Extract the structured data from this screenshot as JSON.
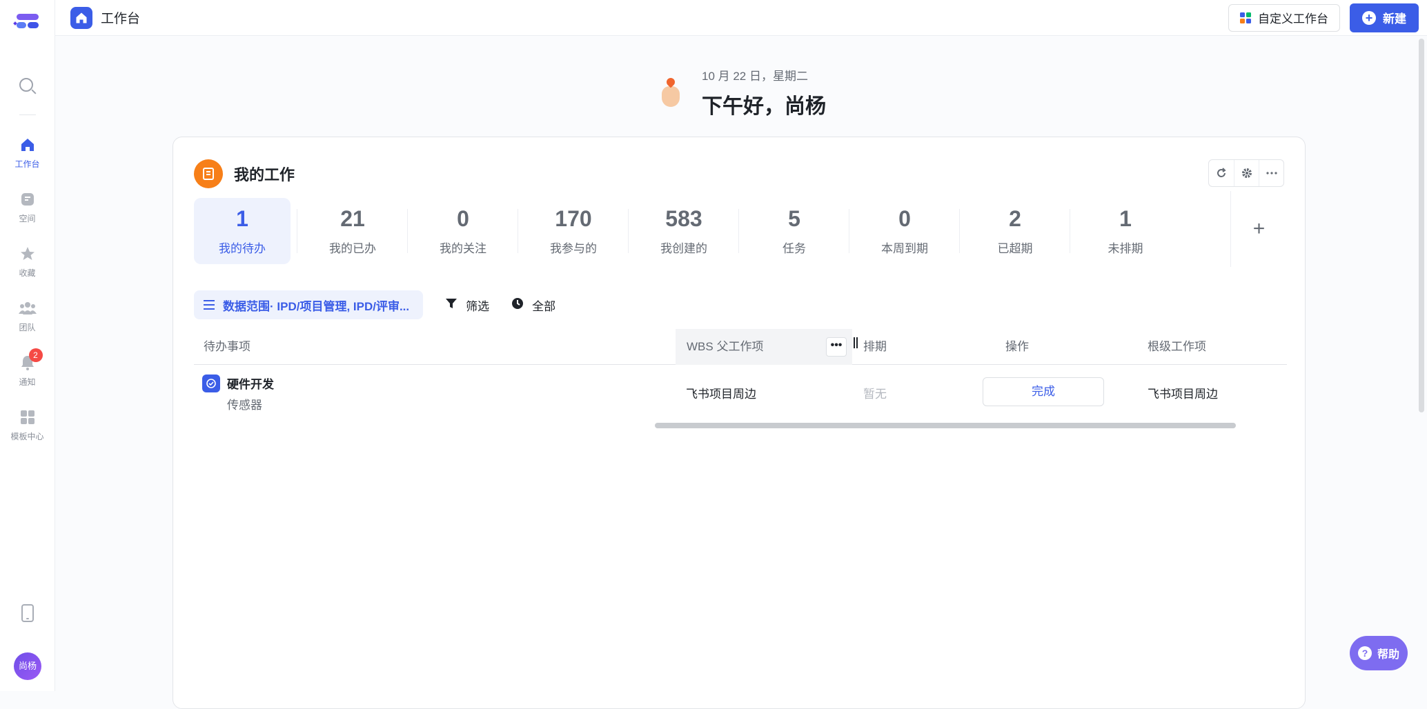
{
  "sidebar": {
    "items": [
      {
        "label": "工作台",
        "icon": "home-icon"
      },
      {
        "label": "空间",
        "icon": "space-icon"
      },
      {
        "label": "收藏",
        "icon": "star-icon"
      },
      {
        "label": "团队",
        "icon": "team-icon"
      },
      {
        "label": "通知",
        "icon": "bell-icon",
        "badge": "2"
      },
      {
        "label": "模板中心",
        "icon": "template-icon"
      }
    ],
    "avatar": "尚杨"
  },
  "topbar": {
    "title": "工作台",
    "customize_label": "自定义工作台",
    "new_label": "新建"
  },
  "greeting": {
    "date": "10 月 22 日，星期二",
    "message": "下午好，尚杨"
  },
  "card": {
    "title": "我的工作",
    "stats": [
      {
        "value": "1",
        "label": "我的待办"
      },
      {
        "value": "21",
        "label": "我的已办"
      },
      {
        "value": "0",
        "label": "我的关注"
      },
      {
        "value": "170",
        "label": "我参与的"
      },
      {
        "value": "583",
        "label": "我创建的"
      },
      {
        "value": "5",
        "label": "任务"
      },
      {
        "value": "0",
        "label": "本周到期"
      },
      {
        "value": "2",
        "label": "已超期"
      },
      {
        "value": "1",
        "label": "未排期"
      }
    ],
    "add_stat": "+",
    "filters": {
      "range": "数据范围· IPD/项目管理, IPD/评审...",
      "filter": "筛选",
      "all": "全部"
    },
    "table": {
      "headers": [
        "待办事项",
        "WBS 父工作项",
        "排期",
        "操作",
        "根级工作项"
      ],
      "more": "•••",
      "rows": [
        {
          "name": "硬件开发",
          "sub": "传感器",
          "wbs_parent": "飞书项目周边",
          "schedule": "暂无",
          "action": "完成",
          "root": "飞书项目周边"
        }
      ]
    }
  },
  "help_label": "帮助",
  "colors": {
    "accent": "#3b5de7",
    "orange": "#f77f18",
    "help": "#7e6cf0",
    "badge": "#f54a45"
  }
}
